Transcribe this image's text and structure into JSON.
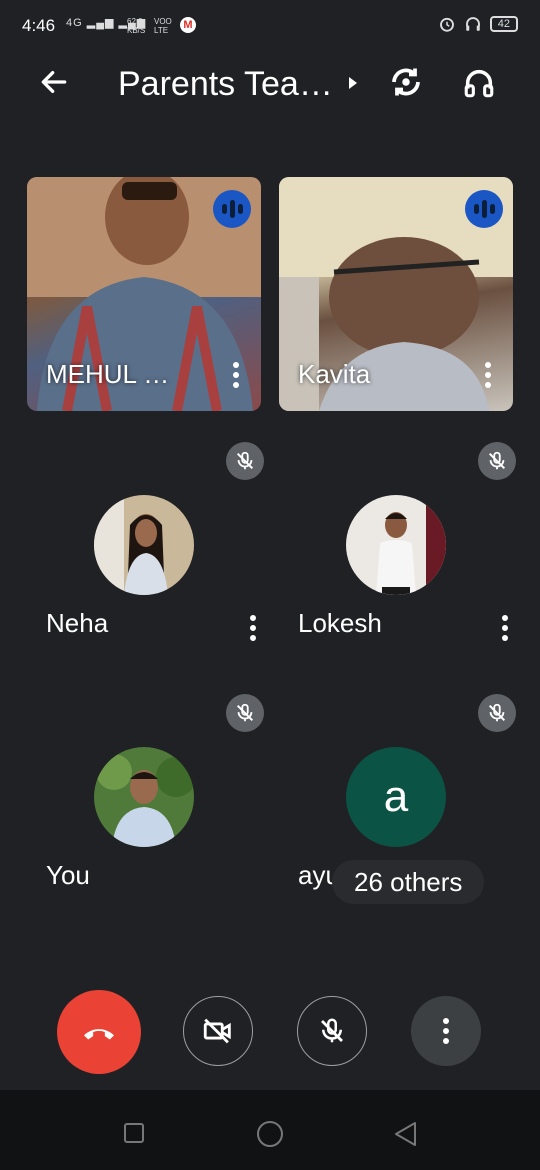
{
  "status_bar": {
    "time": "4:46",
    "network": "4G",
    "speed": "62.0",
    "speed_unit": "KB/S",
    "volte_top": "VOO",
    "volte_bottom": "LTE",
    "battery": "42"
  },
  "header": {
    "title": "Parents Tea…"
  },
  "video_tiles": [
    {
      "name": "MEHUL …"
    },
    {
      "name": "Kavita"
    }
  ],
  "participants": [
    {
      "name": "Neha"
    },
    {
      "name": "Lokesh"
    },
    {
      "name": "You"
    },
    {
      "name": "ayushi",
      "initial": "a"
    }
  ],
  "others_label": "26 others",
  "colors": {
    "background": "#202124",
    "speaking_indicator": "#1a56c4",
    "hangup": "#ea4335",
    "initial_avatar": "#0b5345"
  }
}
